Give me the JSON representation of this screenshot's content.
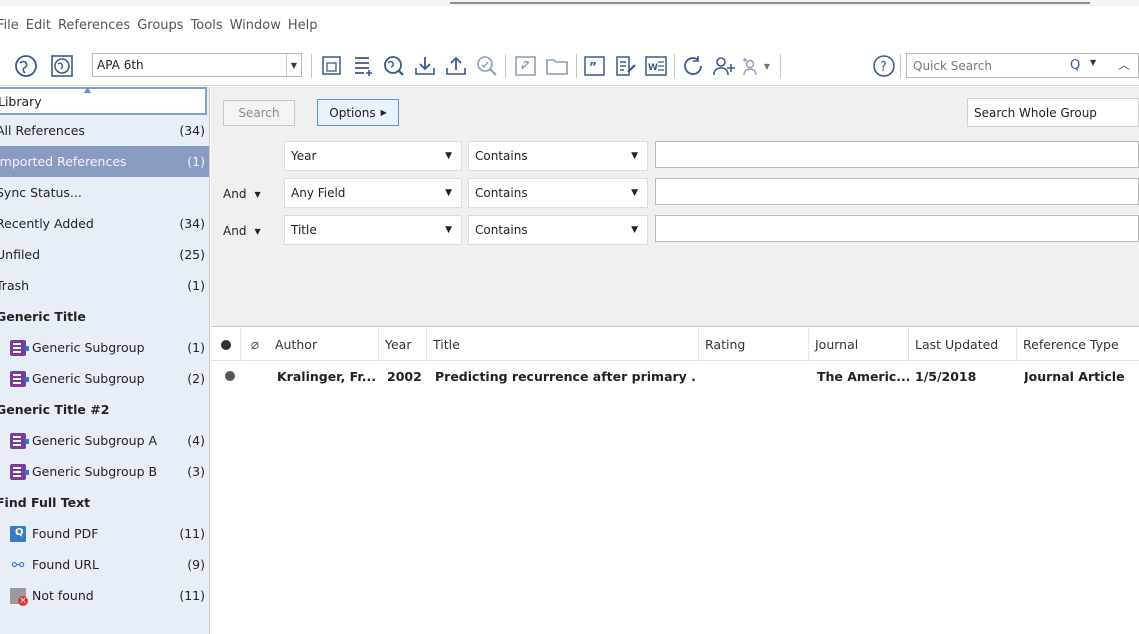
{
  "menu": [
    "File",
    "Edit",
    "References",
    "Groups",
    "Tools",
    "Window",
    "Help"
  ],
  "toolbar": {
    "style": "APA 6th",
    "quick_search_placeholder": "Quick Search"
  },
  "sidebar": {
    "library_label": "Library",
    "items": [
      {
        "label": "All References",
        "count": "(34)"
      },
      {
        "label": "Imported References",
        "count": "(1)"
      },
      {
        "label": "Sync Status...",
        "count": ""
      },
      {
        "label": "Recently Added",
        "count": "(34)"
      },
      {
        "label": "Unfiled",
        "count": "(25)"
      },
      {
        "label": "Trash",
        "count": "(1)"
      }
    ],
    "groups": [
      {
        "title": "Generic Title",
        "items": [
          {
            "label": "Generic Subgroup",
            "count": "(1)"
          },
          {
            "label": "Generic Subgroup",
            "count": "(2)"
          }
        ]
      },
      {
        "title": "Generic Title #2",
        "items": [
          {
            "label": "Generic Subgroup A",
            "count": "(4)"
          },
          {
            "label": "Generic Subgroup B",
            "count": "(3)"
          }
        ]
      }
    ],
    "find_full_text": {
      "title": "Find Full Text",
      "items": [
        {
          "label": "Found PDF",
          "count": "(11)"
        },
        {
          "label": "Found URL",
          "count": "(9)"
        },
        {
          "label": "Not found",
          "count": "(11)"
        }
      ]
    }
  },
  "search": {
    "search_button": "Search",
    "options_button": "Options",
    "scope": "Search Whole Group",
    "rows": [
      {
        "bool": "",
        "field": "Year",
        "op": "Contains",
        "value": ""
      },
      {
        "bool": "And",
        "field": "Any Field",
        "op": "Contains",
        "value": ""
      },
      {
        "bool": "And",
        "field": "Title",
        "op": "Contains",
        "value": ""
      }
    ]
  },
  "references": {
    "columns": [
      "Author",
      "Year",
      "Title",
      "Rating",
      "Journal",
      "Last Updated",
      "Reference Type"
    ],
    "rows": [
      {
        "author": "Kralinger, Fr...",
        "year": "2002",
        "title": "Predicting recurrence after primary ...",
        "rating": "",
        "journal": "The Americ...",
        "last_updated": "1/5/2018",
        "type": "Journal Article"
      }
    ]
  },
  "colors": {
    "selected_row": "#8a9bc2",
    "sidebar_bg": "#e8eef8",
    "group_icon": "#7a3c9c",
    "accent": "#3a6fb5"
  }
}
